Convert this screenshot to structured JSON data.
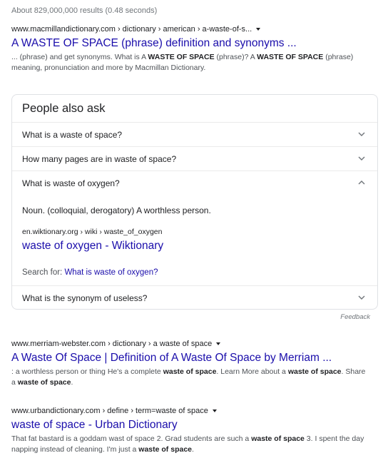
{
  "stats": "About 829,000,000 results (0.48 seconds)",
  "results": [
    {
      "cite": "www.macmillandictionary.com › dictionary › american › a-waste-of-s...",
      "title": "A WASTE OF SPACE (phrase) definition and synonyms ...",
      "snippet_html": "... (phrase) and get synonyms. What is A <b>WASTE OF SPACE</b> (phrase)? A <b>WASTE OF SPACE</b> (phrase) meaning, pronunciation and more by Macmillan Dictionary."
    },
    {
      "cite": "www.merriam-webster.com › dictionary › a waste of space",
      "title": "A Waste Of Space | Definition of A Waste Of Space by Merriam ...",
      "snippet_html": ": a worthless person or thing He's a complete <b>waste of space</b>. Learn More about a <b>waste of space</b>. Share a <b>waste of space</b>."
    },
    {
      "cite": "www.urbandictionary.com › define › term=waste of space",
      "title": "waste of space - Urban Dictionary",
      "snippet_html": "That fat bastard is a goddam wast of space 2. Grad students are such a <b>waste of space</b> 3. I spent the day napping instead of cleaning. I'm just a <b>waste of space</b>."
    }
  ],
  "paa": {
    "heading": "People also ask",
    "questions": [
      "What is a waste of space?",
      "How many pages are in waste of space?",
      "What is waste of oxygen?",
      "What is the synonym of useless?"
    ],
    "answer": {
      "text": "Noun. (colloquial, derogatory) A worthless person.",
      "cite": "en.wiktionary.org › wiki › waste_of_oxygen",
      "title": "waste of oxygen - Wiktionary",
      "search_for_label": "Search for:",
      "search_for_link": "What is waste of oxygen?"
    }
  },
  "feedback": "Feedback"
}
